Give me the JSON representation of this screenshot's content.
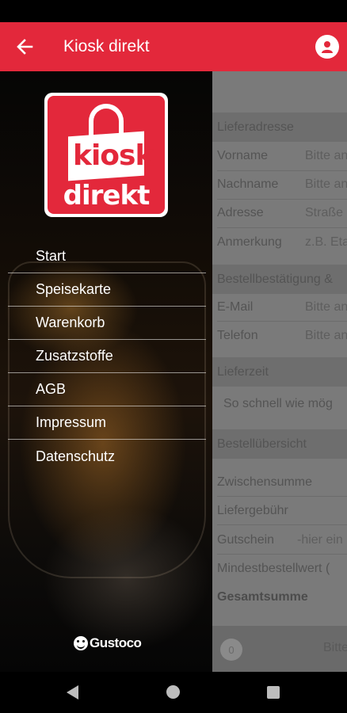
{
  "app_bar": {
    "title": "Kiosk direkt",
    "back_icon": "arrow-left-icon",
    "profile_icon": "account-icon",
    "color": "#e3283b"
  },
  "logo": {
    "line1": "kiosk",
    "line2": "direkt"
  },
  "drawer": {
    "items": [
      {
        "label": "Start"
      },
      {
        "label": "Speisekarte"
      },
      {
        "label": "Warenkorb"
      },
      {
        "label": "Zusatzstoffe"
      },
      {
        "label": "AGB"
      },
      {
        "label": "Impressum"
      },
      {
        "label": "Datenschutz"
      }
    ],
    "footer_brand": "Gustoco"
  },
  "form": {
    "delivery_address_header": "Lieferadresse",
    "first_name_label": "Vorname",
    "first_name_placeholder": "Bitte an",
    "last_name_label": "Nachname",
    "last_name_placeholder": "Bitte an",
    "address_label": "Adresse",
    "address_placeholder": "Straße",
    "note_label": "Anmerkung",
    "note_placeholder": "z.B. Eta",
    "confirmation_header": "Bestellbestätigung &",
    "email_label": "E-Mail",
    "email_placeholder": "Bitte an",
    "phone_label": "Telefon",
    "phone_placeholder": "Bitte an",
    "delivery_time_header": "Lieferzeit",
    "delivery_time_value": "So schnell wie mög",
    "order_overview_header": "Bestellübersicht",
    "subtotal_label": "Zwischensumme",
    "delivery_fee_label": "Liefergebühr",
    "voucher_label": "Gutschein",
    "voucher_placeholder": "-hier ein",
    "min_order_label": "Mindestbestellwert (",
    "total_label": "Gesamtsumme"
  },
  "bottom_bar": {
    "count": "0",
    "text": "Bitte"
  }
}
